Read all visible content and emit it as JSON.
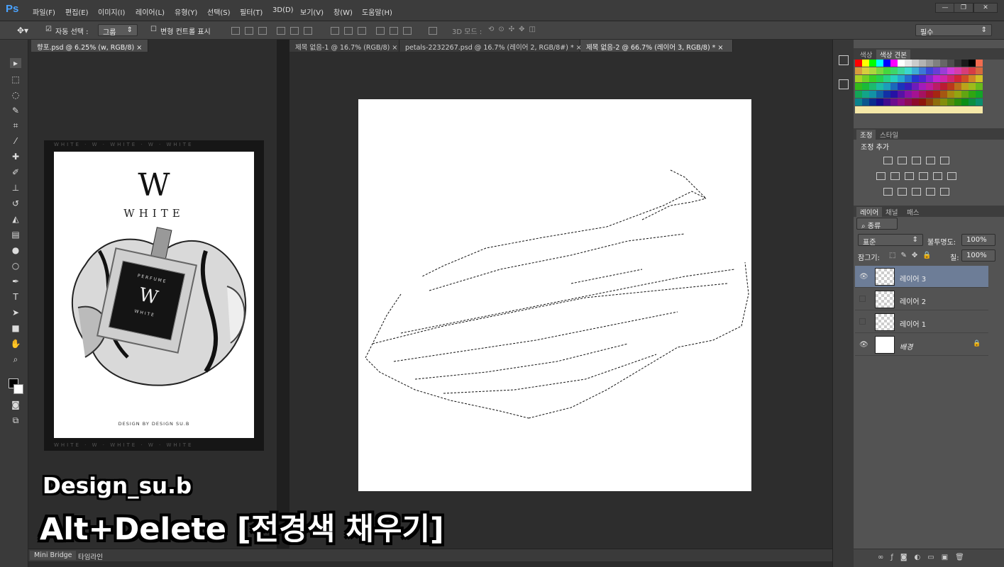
{
  "app": {
    "logo": "Ps"
  },
  "menu": [
    "파일(F)",
    "편집(E)",
    "이미지(I)",
    "레이어(L)",
    "유형(Y)",
    "선택(S)",
    "필터(T)",
    "3D(D)",
    "보기(V)",
    "창(W)",
    "도움말(H)"
  ],
  "window_controls": {
    "minimize": "—",
    "restore": "❐",
    "close": "✕"
  },
  "options": {
    "auto_select_label": "자동 선택 :",
    "auto_select_checked": true,
    "auto_select_value": "그룹",
    "transform_label": "변형 컨트롤 표시",
    "mode_3d_label": "3D 모드 :",
    "workspace": "필수"
  },
  "tabs_left": [
    {
      "label": "향포.psd @ 6.25% (w, RGB/8)"
    }
  ],
  "tabs_right": [
    {
      "label": "제목 없음-1 @ 16.7% (RGB/8)"
    },
    {
      "label": "petals-2232267.psd @ 16.7% (레이어 2, RGB/8#) *"
    },
    {
      "label": "제목 없음-2 @ 66.7% (레이어 3, RGB/8) *"
    }
  ],
  "poster": {
    "letter": "W",
    "brand": "WHITE",
    "bottle_top": "PERFUME",
    "bottle_letter": "W",
    "bottle_sub": "WHITE",
    "footer": "DESIGN BY DESIGN SU.B",
    "border_text": "WHITE  ·  W  ·  WHITE  ·  W  ·  WHITE"
  },
  "bottom_tabs": [
    "Mini Bridge",
    "타임라인"
  ],
  "color_panel": {
    "tabs": [
      "색상",
      "색상 견본"
    ]
  },
  "adjust_panel": {
    "tabs": [
      "조정",
      "스타일"
    ],
    "title": "조정 추가"
  },
  "layers_panel": {
    "tabs": [
      "레이어",
      "채널",
      "패스"
    ],
    "filter_label": "종류",
    "blend_mode": "표준",
    "opacity_label": "불투명도:",
    "opacity": "100%",
    "lock_label": "잠그기:",
    "fill_label": "칠:",
    "fill": "100%",
    "layers": [
      {
        "name": "레이어 3",
        "visible": true,
        "selected": true
      },
      {
        "name": "레이어 2",
        "visible": false,
        "selected": false
      },
      {
        "name": "레이어 1",
        "visible": false,
        "selected": false
      },
      {
        "name": "배경",
        "visible": true,
        "selected": false,
        "locked": true
      }
    ]
  },
  "captions": {
    "line1": "Design_su.b",
    "line2": "Alt+Delete [전경색 채우기]"
  }
}
